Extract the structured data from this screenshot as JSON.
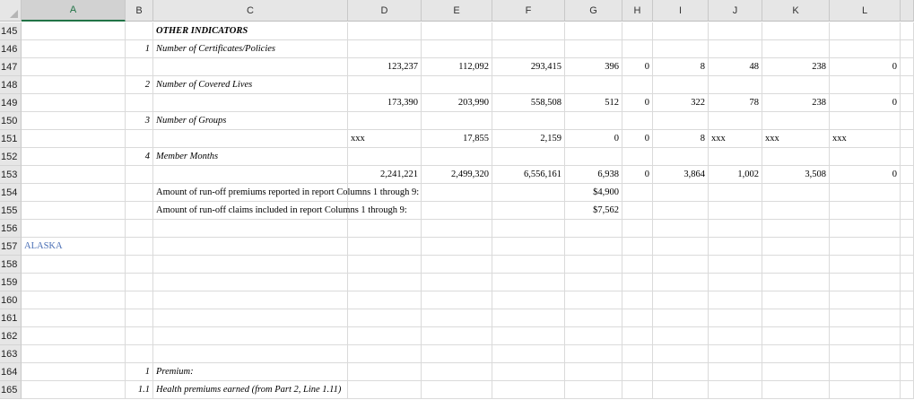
{
  "columns": [
    "A",
    "B",
    "C",
    "D",
    "E",
    "F",
    "G",
    "H",
    "I",
    "J",
    "K",
    "L"
  ],
  "active_column": "A",
  "rows": [
    {
      "num": "145",
      "cells": {
        "C": "OTHER INDICATORS"
      }
    },
    {
      "num": "146",
      "cells": {
        "B": "1",
        "C": "Number of Certificates/Policies"
      }
    },
    {
      "num": "147",
      "cells": {
        "D": "123,237",
        "E": "112,092",
        "F": "293,415",
        "G": "396",
        "H": "0",
        "I": "8",
        "J": "48",
        "K": "238",
        "L": "0"
      }
    },
    {
      "num": "148",
      "cells": {
        "B": "2",
        "C": "Number of Covered Lives"
      }
    },
    {
      "num": "149",
      "cells": {
        "D": "173,390",
        "E": "203,990",
        "F": "558,508",
        "G": "512",
        "H": "0",
        "I": "322",
        "J": "78",
        "K": "238",
        "L": "0"
      }
    },
    {
      "num": "150",
      "cells": {
        "B": "3",
        "C": "Number of Groups"
      }
    },
    {
      "num": "151",
      "cells": {
        "D": "xxx",
        "E": "17,855",
        "F": "2,159",
        "G": "0",
        "H": "0",
        "I": "8",
        "J": "xxx",
        "K": "xxx",
        "L": "xxx"
      }
    },
    {
      "num": "152",
      "cells": {
        "B": "4",
        "C": "Member Months"
      }
    },
    {
      "num": "153",
      "cells": {
        "D": "2,241,221",
        "E": "2,499,320",
        "F": "6,556,161",
        "G": "6,938",
        "H": "0",
        "I": "3,864",
        "J": "1,002",
        "K": "3,508",
        "L": "0"
      }
    },
    {
      "num": "154",
      "cells": {
        "C": "Amount of run-off premiums reported in report Columns 1 through 9:",
        "G": "$4,900"
      }
    },
    {
      "num": "155",
      "cells": {
        "C": "Amount of run-off claims included in report Columns 1 through 9:",
        "G": "$7,562"
      }
    },
    {
      "num": "156",
      "cells": {}
    },
    {
      "num": "157",
      "cells": {
        "A": "ALASKA"
      }
    },
    {
      "num": "158",
      "cells": {}
    },
    {
      "num": "159",
      "cells": {}
    },
    {
      "num": "160",
      "cells": {}
    },
    {
      "num": "161",
      "cells": {}
    },
    {
      "num": "162",
      "cells": {}
    },
    {
      "num": "163",
      "cells": {}
    },
    {
      "num": "164",
      "cells": {
        "B": "1",
        "C": "Premium:"
      }
    },
    {
      "num": "165",
      "cells": {
        "B": "1.1",
        "C": "Health premiums earned (from Part 2, Line 1.11)"
      }
    }
  ]
}
